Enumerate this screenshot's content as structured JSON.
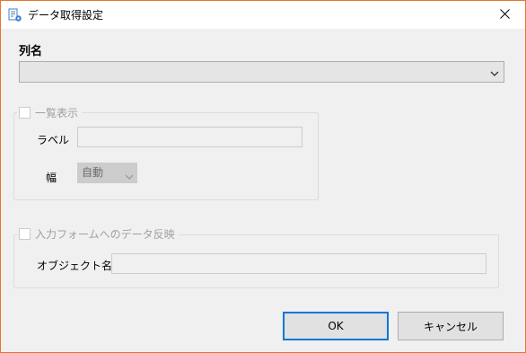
{
  "window": {
    "title": "データ取得設定",
    "app_icon": "data-settings-icon",
    "close_icon": "close-icon",
    "border_color": "#e8762c"
  },
  "column": {
    "label": "列名",
    "selected_value": ""
  },
  "list_display": {
    "checkbox_label": "一覧表示",
    "checked": false,
    "label_field_label": "ラベル",
    "label_field_value": "",
    "width_label": "幅",
    "width_value": "自動"
  },
  "form_reflect": {
    "checkbox_label": "入力フォームへのデータ反映",
    "checked": false,
    "object_name_label": "オブジェクト名",
    "object_name_value": ""
  },
  "buttons": {
    "ok": "OK",
    "cancel": "キャンセル"
  },
  "colors": {
    "accent": "#0078d7",
    "dialog_bg": "#f0f0f0",
    "disabled_text": "#a0a0a0"
  }
}
